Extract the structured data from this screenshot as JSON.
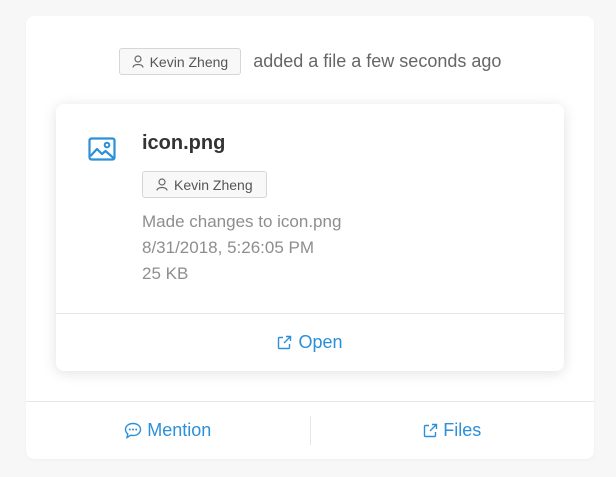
{
  "activity": {
    "user": "Kevin Zheng",
    "text": "added a file a few seconds ago"
  },
  "file": {
    "name": "icon.png",
    "owner": "Kevin Zheng",
    "change_text": "Made changes to icon.png",
    "timestamp": "8/31/2018, 5:26:05 PM",
    "size": "25 KB",
    "open_label": "Open",
    "icon": "image-icon"
  },
  "footer": {
    "mention_label": "Mention",
    "files_label": "Files"
  },
  "colors": {
    "accent": "#2b8fd9",
    "muted_text": "#8e8e8e"
  }
}
